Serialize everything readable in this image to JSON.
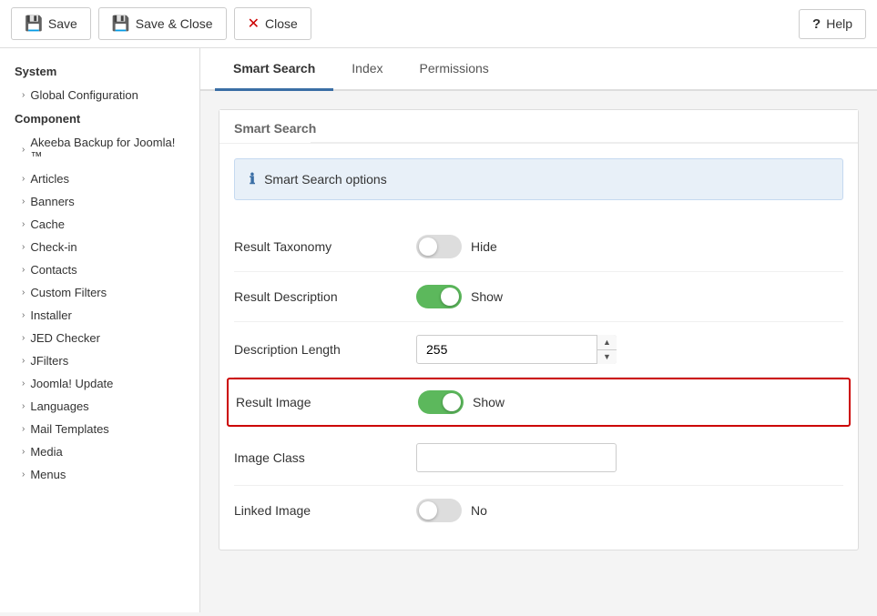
{
  "toolbar": {
    "save_label": "Save",
    "save_close_label": "Save & Close",
    "close_label": "Close",
    "help_label": "Help"
  },
  "sidebar": {
    "section1": "System",
    "section2": "Component",
    "items": [
      {
        "label": "Global Configuration",
        "level": 1
      },
      {
        "label": "Articles",
        "level": 2
      },
      {
        "label": "Banners",
        "level": 2
      },
      {
        "label": "Cache",
        "level": 2
      },
      {
        "label": "Check-in",
        "level": 2
      },
      {
        "label": "Contacts",
        "level": 2
      },
      {
        "label": "Custom Filters",
        "level": 2
      },
      {
        "label": "Installer",
        "level": 2
      },
      {
        "label": "JED Checker",
        "level": 2
      },
      {
        "label": "JFilters",
        "level": 2
      },
      {
        "label": "Joomla! Update",
        "level": 2
      },
      {
        "label": "Languages",
        "level": 2
      },
      {
        "label": "Mail Templates",
        "level": 2
      },
      {
        "label": "Media",
        "level": 2
      },
      {
        "label": "Menus",
        "level": 2
      }
    ]
  },
  "tabs": [
    {
      "label": "Smart Search",
      "active": true
    },
    {
      "label": "Index",
      "active": false
    },
    {
      "label": "Permissions",
      "active": false
    }
  ],
  "panel": {
    "title": "Smart Search",
    "info_text": "Smart Search options"
  },
  "form": {
    "rows": [
      {
        "label": "Result Taxonomy",
        "control_type": "toggle",
        "toggle_on": false,
        "toggle_text": "Hide"
      },
      {
        "label": "Result Description",
        "control_type": "toggle",
        "toggle_on": true,
        "toggle_text": "Show"
      },
      {
        "label": "Description Length",
        "control_type": "number",
        "value": "255"
      },
      {
        "label": "Result Image",
        "control_type": "toggle",
        "toggle_on": true,
        "toggle_text": "Show",
        "highlighted": true
      },
      {
        "label": "Image Class",
        "control_type": "text",
        "value": ""
      },
      {
        "label": "Linked Image",
        "control_type": "toggle",
        "toggle_on": false,
        "toggle_text": "No"
      }
    ]
  }
}
